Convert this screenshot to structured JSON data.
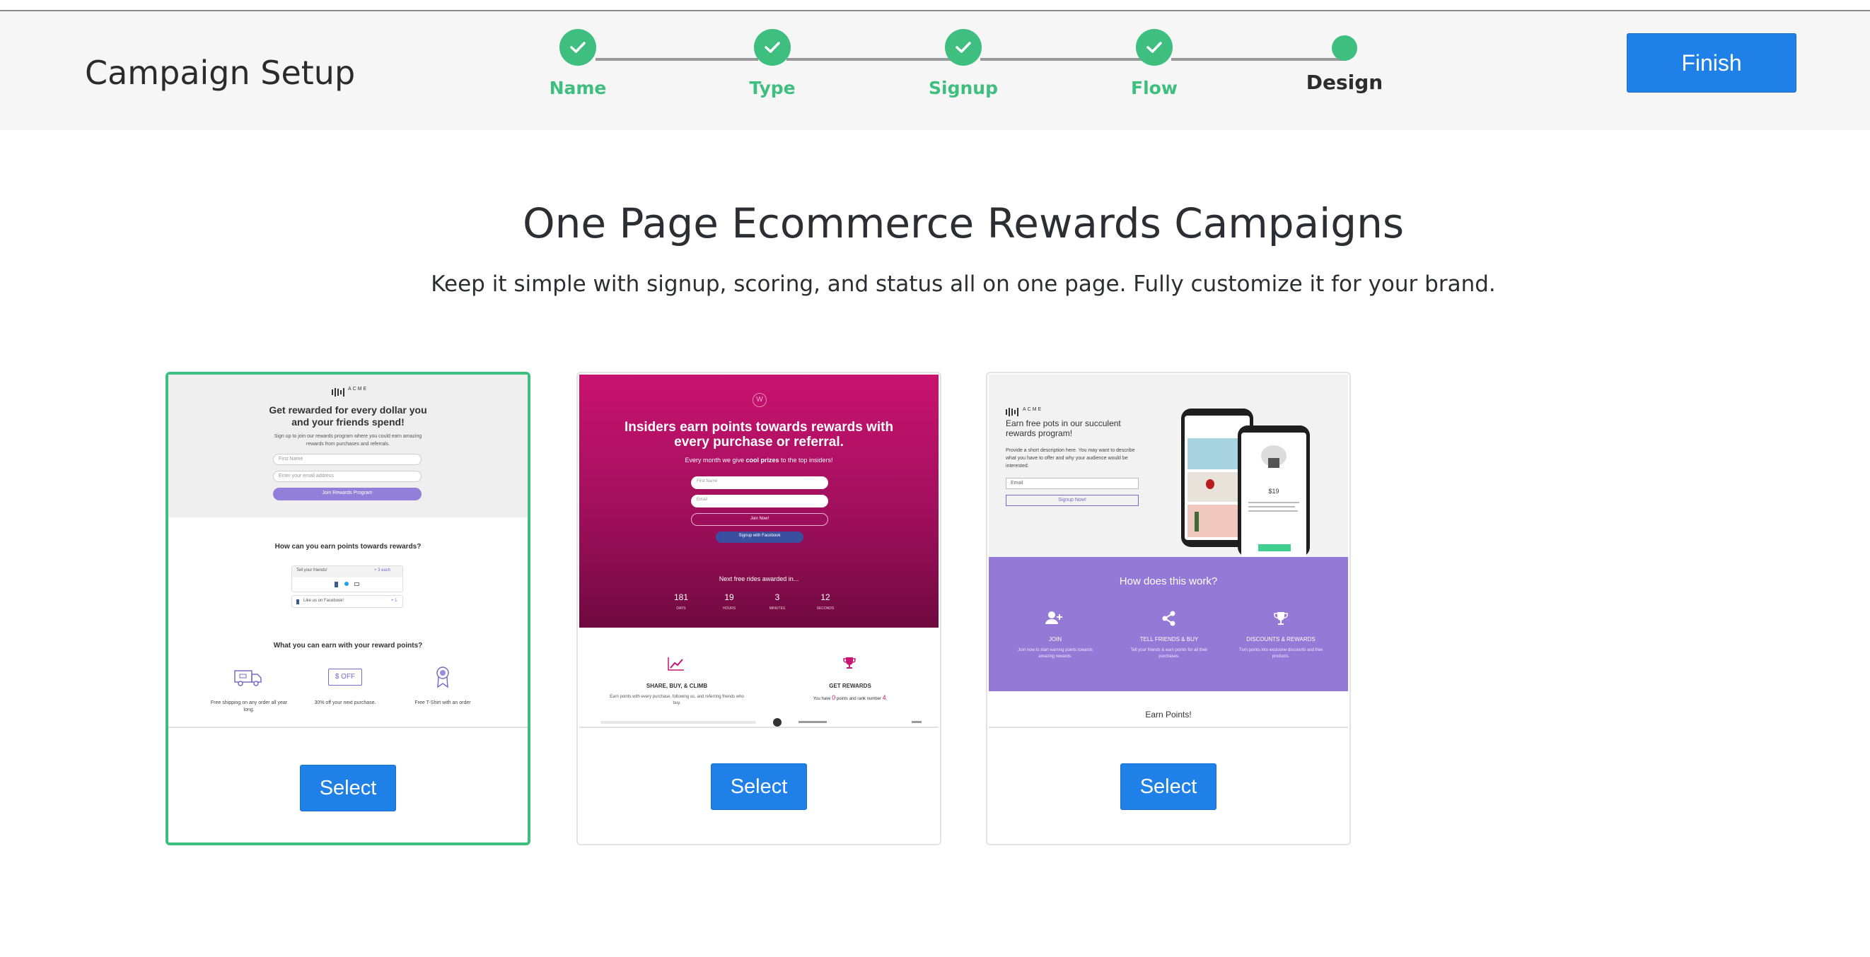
{
  "header": {
    "title": "Campaign Setup",
    "finish_label": "Finish",
    "steps": [
      {
        "label": "Name",
        "status": "complete"
      },
      {
        "label": "Type",
        "status": "complete"
      },
      {
        "label": "Signup",
        "status": "complete"
      },
      {
        "label": "Flow",
        "status": "complete"
      },
      {
        "label": "Design",
        "status": "current"
      }
    ]
  },
  "main": {
    "title": "One Page Ecommerce Rewards Campaigns",
    "subtitle": "Keep it simple with signup, scoring, and status all on one page. Fully customize it for your brand."
  },
  "colors": {
    "accent_green": "#3fbf7f",
    "button_blue": "#1f80e8",
    "magenta": "#c8156f",
    "purple": "#9479d6"
  },
  "cards": [
    {
      "select_label": "Select",
      "selected": true,
      "preview": {
        "brand": "ACME",
        "headline": "Get rewarded for every dollar you and your friends spend!",
        "intro": "Sign up to join our rewards program where you could earn amazing rewards from purchases and referrals.",
        "first_name_placeholder": "First Name",
        "email_placeholder": "Enter your email address",
        "join_label": "Join Rewards Program",
        "earn_heading": "How can you earn points towards rewards?",
        "tell_friends": "Tell your friends!",
        "tell_points": "+ 3 each",
        "like_facebook": "Like us on Facebook!",
        "like_points": "+ 1",
        "reward_heading": "What you can earn with your reward points?",
        "rewards": [
          {
            "icon": "truck-icon",
            "label": "Free shipping on any order all year long."
          },
          {
            "icon": "coupon-icon",
            "icon_text": "$ OFF",
            "label": "30% off your next purchase."
          },
          {
            "icon": "award-ribbon-icon",
            "label": "Free T-Shirt with an order"
          }
        ]
      }
    },
    {
      "select_label": "Select",
      "selected": false,
      "preview": {
        "logo_letter": "W",
        "headline": "Insiders earn points towards rewards with every purchase or referral.",
        "sub_prefix": "Every month we give ",
        "sub_bold": "cool prizes",
        "sub_suffix": " to the top insiders!",
        "first_name_placeholder": "First Name",
        "email_placeholder": "Email",
        "join_label": "Join Now!",
        "facebook_label": "Signup with Facebook",
        "countdown_title": "Next free rides awarded in...",
        "countdown": [
          {
            "value": "181",
            "unit": "DAYS"
          },
          {
            "value": "19",
            "unit": "HOURS"
          },
          {
            "value": "3",
            "unit": "MINUTES"
          },
          {
            "value": "12",
            "unit": "SECONDS"
          }
        ],
        "col1_title": "SHARE, BUY, & CLIMB",
        "col1_text": "Earn points with every purchase, following us, and referring friends who buy.",
        "col2_title": "GET REWARDS",
        "col2_prefix": "You have ",
        "col2_points": "0",
        "col2_mid": " points and rank number ",
        "col2_rank": "4",
        "col2_suffix": "."
      }
    },
    {
      "select_label": "Select",
      "selected": false,
      "preview": {
        "brand": "ACME",
        "headline": "Earn free pots in our succulent rewards program!",
        "desc": "Provide a short description here. You may want to describe what you have to offer and why your audience would be interested.",
        "email_placeholder": "Email",
        "signup_label": "Signup Now!",
        "phone_price": "$19",
        "how_title": "How does this work?",
        "steps": [
          {
            "icon": "add-user-icon",
            "title": "JOIN",
            "text": "Join now to start earning points towards amazing rewards."
          },
          {
            "icon": "share-icon",
            "title": "TELL FRIENDS & BUY",
            "text": "Tell your friends & earn points for all their purchases."
          },
          {
            "icon": "trophy-icon",
            "title": "DISCOUNTS & REWARDS",
            "text": "Turn points into exclusive discounts and free products."
          }
        ],
        "earn_title": "Earn Points!"
      }
    }
  ]
}
